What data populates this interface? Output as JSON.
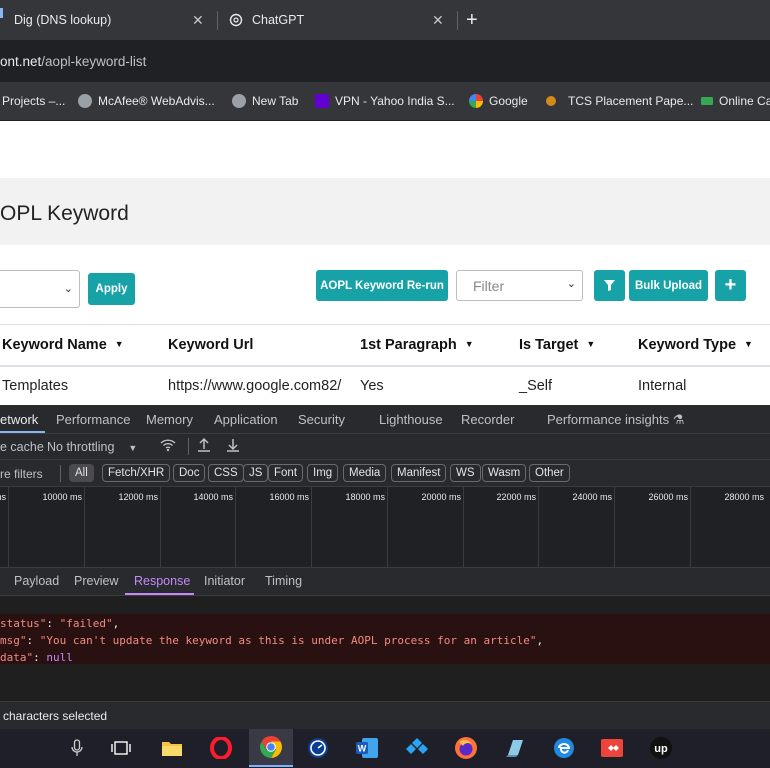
{
  "tabs": [
    {
      "label": "Dig (DNS lookup)"
    },
    {
      "label": "ChatGPT"
    }
  ],
  "address": {
    "host": "ont.net",
    "path": "/aopl-keyword-list"
  },
  "bookmarks": [
    "Projects –...",
    "McAfee® WebAdvis...",
    "New Tab",
    "VPN - Yahoo India S...",
    "Google",
    "TCS Placement Pape...",
    "Online Ca"
  ],
  "page": {
    "title": "OPL Keyword",
    "apply_label": "Apply",
    "rerun_label": "AOPL Keyword Re-run",
    "filter_placeholder": "Filter",
    "bulk_upload_label": "Bulk Upload",
    "add_label": "+",
    "columns": [
      "Keyword Name",
      "Keyword Url",
      "1st Paragraph",
      "Is Target",
      "Keyword Type"
    ],
    "rows": [
      [
        "Templates",
        "https://www.google.com82/",
        "Yes",
        "_Self",
        "Internal"
      ]
    ]
  },
  "devtools": {
    "tabs": [
      "etwork",
      "Performance",
      "Memory",
      "Application",
      "Security",
      "Lighthouse",
      "Recorder",
      "Performance insights"
    ],
    "cache_label": "e cache",
    "throttle_label": "No throttling",
    "filters_label": "re filters",
    "filter_chips": [
      "All",
      "Fetch/XHR",
      "Doc",
      "CSS",
      "JS",
      "Font",
      "Img",
      "Media",
      "Manifest",
      "WS",
      "Wasm",
      "Other"
    ],
    "timeline_labels": [
      "ms",
      "10000 ms",
      "12000 ms",
      "14000 ms",
      "16000 ms",
      "18000 ms",
      "20000 ms",
      "22000 ms",
      "24000 ms",
      "26000 ms",
      "28000 ms"
    ],
    "subtabs": [
      "Payload",
      "Preview",
      "Response",
      "Initiator",
      "Timing"
    ],
    "response": {
      "l1_key": "status\"",
      "l1_val": "\"failed\"",
      "l2_key": "msg\"",
      "l2_val": "\"You can't update the keyword as this is under AOPL process for an article\"",
      "l3_key": "data\"",
      "l3_val": "null"
    },
    "status_text": "characters selected"
  },
  "colors": {
    "accent": "#17a2a8",
    "error_bg": "#2a1111"
  }
}
